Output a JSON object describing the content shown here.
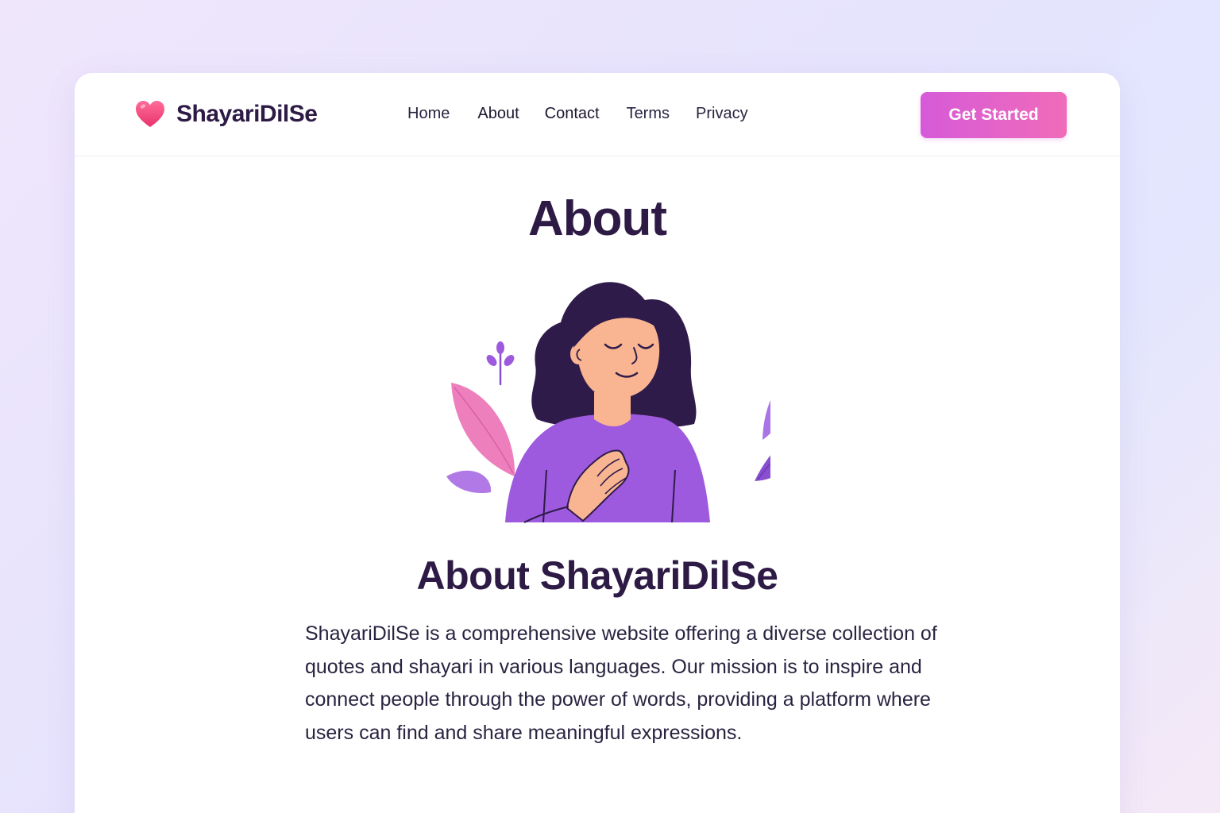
{
  "brand": {
    "name": "ShayariDilSe",
    "logo_icon": "heart-icon",
    "logo_color": "#f0407a"
  },
  "nav": {
    "links": [
      "Home",
      "About",
      "Contact",
      "Terms",
      "Privacy"
    ],
    "cta_label": "Get Started"
  },
  "page": {
    "title": "About"
  },
  "about": {
    "heading": "About ShayariDilSe",
    "description": "ShayariDilSe is a comprehensive website offering a diverse collection of quotes and shayari in various languages. Our mission is to inspire and connect people through the power of words, providing a platform where users can find and share meaningful expressions."
  },
  "colors": {
    "accent_start": "#d65ad9",
    "accent_end": "#f06cb9",
    "heading": "#2d1b45",
    "illustration_purple": "#9d5ade"
  }
}
